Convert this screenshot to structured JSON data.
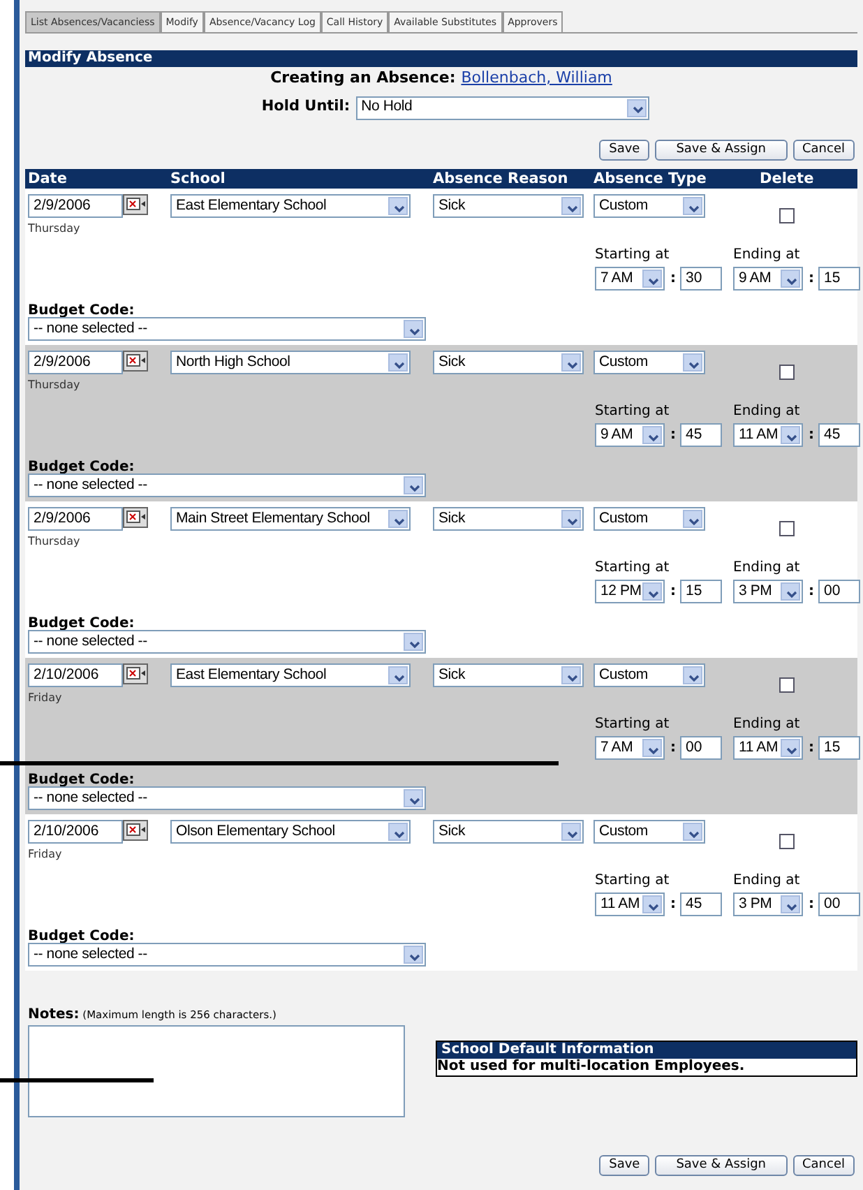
{
  "tabs": [
    {
      "label": "List Absences/Vacanciess",
      "selected": true
    },
    {
      "label": "Modify",
      "selected": false
    },
    {
      "label": "Absence/Vacancy Log",
      "selected": false
    },
    {
      "label": "Call History",
      "selected": false
    },
    {
      "label": "Available Substitutes",
      "selected": false
    },
    {
      "label": "Approvers",
      "selected": false
    }
  ],
  "panel_title": "Modify Absence",
  "creating_label": "Creating an Absence:",
  "employee_link": "Bollenbach, William",
  "hold_until": {
    "label": "Hold Until:",
    "value": "No Hold"
  },
  "top_buttons": [
    "Save",
    "Save & Assign",
    "Cancel"
  ],
  "columns": [
    "Date",
    "School",
    "Absence Reason",
    "Absence Type",
    "Delete"
  ],
  "absences": [
    {
      "date": "2/9/2006",
      "weekday": "Thursday",
      "school": "East Elementary School",
      "reason": "Sick",
      "type": "Custom",
      "checked": false,
      "start_label": "Starting at",
      "start_hour": "7 AM",
      "start_min": "30",
      "time_separator": ":",
      "end_time_separator": ":",
      "end_label": "Ending at",
      "end_hour": "9 AM",
      "end_min": "15",
      "budget_label": "Budget Code:",
      "budget_value": "-- none selected --"
    },
    {
      "date": "2/9/2006",
      "weekday": "Thursday",
      "school": "North High School",
      "reason": "Sick",
      "type": "Custom",
      "checked": false,
      "start_label": "Starting at",
      "start_hour": "9 AM",
      "start_min": "45",
      "time_separator": ":",
      "end_time_separator": ":",
      "end_label": "Ending at",
      "end_hour": "11 AM",
      "end_min": "45",
      "budget_label": "Budget Code:",
      "budget_value": "-- none selected --"
    },
    {
      "date": "2/9/2006",
      "weekday": "Thursday",
      "school": "Main Street Elementary School",
      "reason": "Sick",
      "type": "Custom",
      "checked": false,
      "start_label": "Starting at",
      "start_hour": "12 PM",
      "start_min": "15",
      "time_separator": ":",
      "end_time_separator": ":",
      "end_label": "Ending at",
      "end_hour": "3 PM",
      "end_min": "00",
      "budget_label": "Budget Code:",
      "budget_value": "-- none selected --"
    },
    {
      "date": "2/10/2006",
      "weekday": "Friday",
      "school": "East Elementary School",
      "reason": "Sick",
      "type": "Custom",
      "checked": false,
      "start_label": "Starting at",
      "start_hour": "7 AM",
      "start_min": "00",
      "time_separator": ":",
      "end_time_separator": ":",
      "end_label": "Ending at",
      "end_hour": "11 AM",
      "end_min": "15",
      "budget_label": "Budget Code:",
      "budget_value": "-- none selected --"
    },
    {
      "date": "2/10/2006",
      "weekday": "Friday",
      "school": "Olson Elementary School",
      "reason": "Sick",
      "type": "Custom",
      "checked": false,
      "start_label": "Starting at",
      "start_hour": "11 AM",
      "start_min": "45",
      "time_separator": ":",
      "end_time_separator": ":",
      "end_label": "Ending at",
      "end_hour": "3 PM",
      "end_min": "00",
      "budget_label": "Budget Code:",
      "budget_value": "-- none selected --"
    }
  ],
  "notes": {
    "label": "Notes:",
    "hint": "(Maximum length is 256 characters.)"
  },
  "school_default": {
    "title": "School Default Information",
    "text": "Not used for multi-location Employees."
  },
  "bottom_buttons": [
    "Save",
    "Save & Assign",
    "Cancel"
  ]
}
